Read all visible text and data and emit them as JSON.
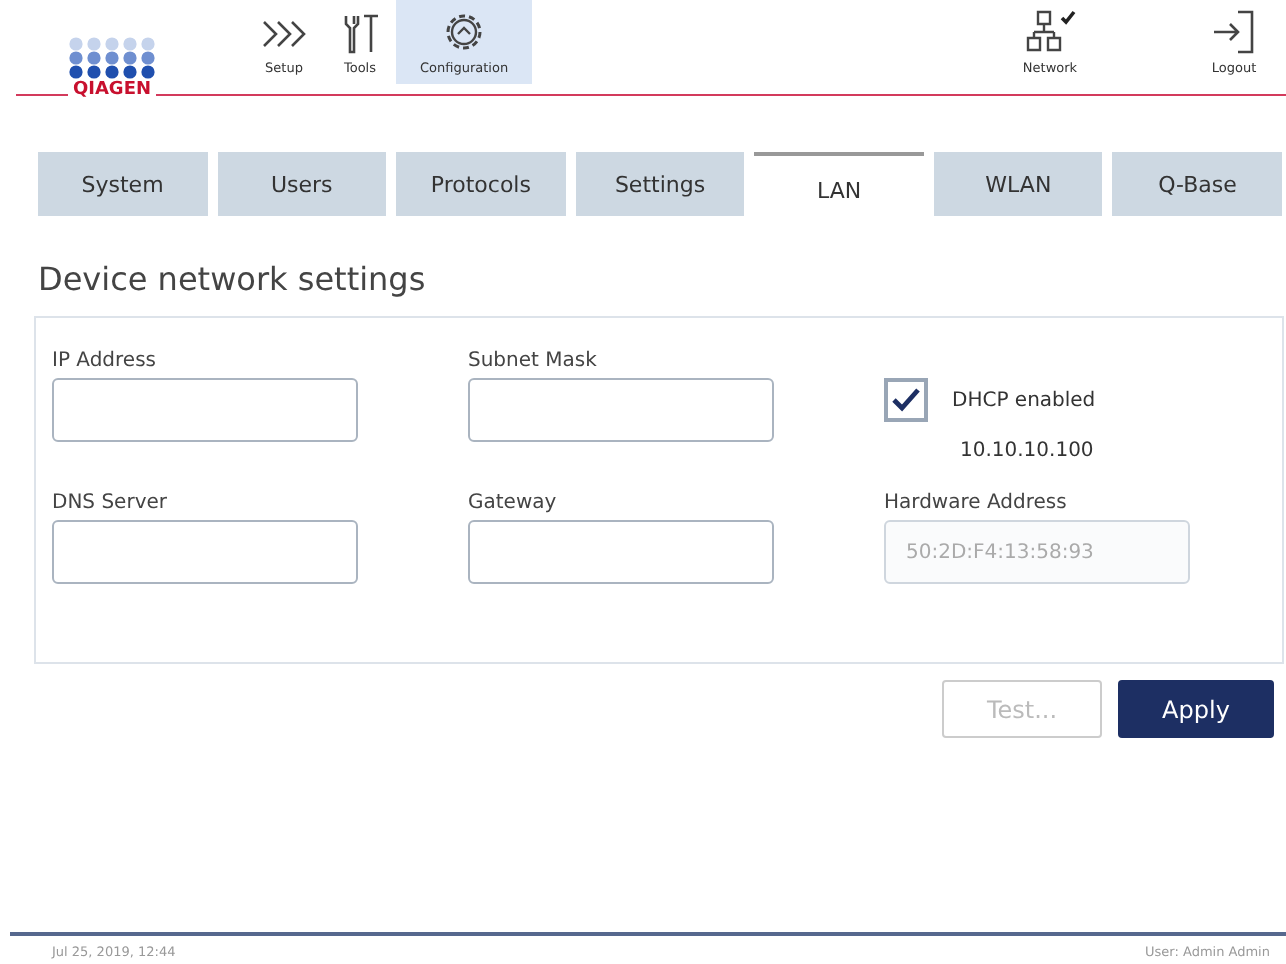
{
  "header": {
    "logo": "QIAGEN",
    "nav": [
      {
        "label": "Setup",
        "selected": false
      },
      {
        "label": "Tools",
        "selected": false
      },
      {
        "label": "Configuration",
        "selected": true
      }
    ],
    "right": [
      {
        "label": "Network"
      },
      {
        "label": "Logout"
      }
    ]
  },
  "tabs": [
    {
      "label": "System",
      "selected": false
    },
    {
      "label": "Users",
      "selected": false
    },
    {
      "label": "Protocols",
      "selected": false
    },
    {
      "label": "Settings",
      "selected": false
    },
    {
      "label": "LAN",
      "selected": true
    },
    {
      "label": "WLAN",
      "selected": false
    },
    {
      "label": "Q-Base",
      "selected": false
    }
  ],
  "title": "Device network settings",
  "fields": [
    {
      "label": "IP Address",
      "disabled": false
    },
    {
      "label": "Subnet Mask",
      "disabled": false
    },
    {
      "label": "DNS Server",
      "disabled": false
    },
    {
      "label": "Gateway",
      "disabled": false
    },
    {
      "label": "Hardware Address",
      "value": "50:2D:F4:13:58:93",
      "disabled": true
    }
  ],
  "dhcp": {
    "label": "DHCP enabled",
    "checked": true,
    "address": "10.10.10.100"
  },
  "buttons": [
    {
      "label": "Test...",
      "disabled": true,
      "kind": "secondary"
    },
    {
      "label": "Apply",
      "disabled": false,
      "kind": "primary"
    }
  ],
  "status_bar": {
    "datetime": "Jul 25, 2019, 12:44",
    "user": "User: Admin Admin"
  }
}
